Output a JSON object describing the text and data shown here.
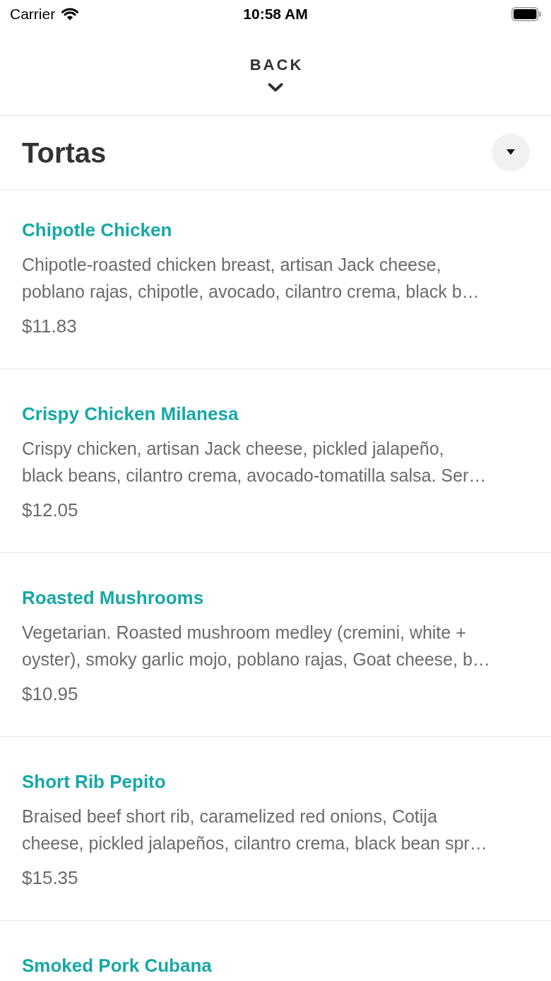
{
  "status_bar": {
    "carrier": "Carrier",
    "time": "10:58 AM"
  },
  "back_button": {
    "label": "BACK"
  },
  "category": {
    "title": "Tortas"
  },
  "menu_items": [
    {
      "name": "Chipotle Chicken",
      "description": "Chipotle-roasted chicken breast, artisan Jack cheese,\npoblano rajas, chipotle, avocado, cilantro crema, black b…",
      "price": "$11.83"
    },
    {
      "name": "Crispy Chicken Milanesa",
      "description": "Crispy chicken, artisan Jack cheese, pickled jalapeño,\nblack beans, cilantro crema, avocado-tomatilla salsa. Ser…",
      "price": "$12.05"
    },
    {
      "name": "Roasted Mushrooms",
      "description": "Vegetarian. Roasted mushroom medley (cremini, white +\noyster), smoky garlic mojo, poblano rajas, Goat cheese, b…",
      "price": "$10.95"
    },
    {
      "name": "Short Rib Pepito",
      "description": "Braised beef short rib, caramelized red onions, Cotija\ncheese, pickled jalapeños, cilantro crema, black bean spr…",
      "price": "$15.35"
    },
    {
      "name": "Smoked Pork Cubana"
    }
  ]
}
